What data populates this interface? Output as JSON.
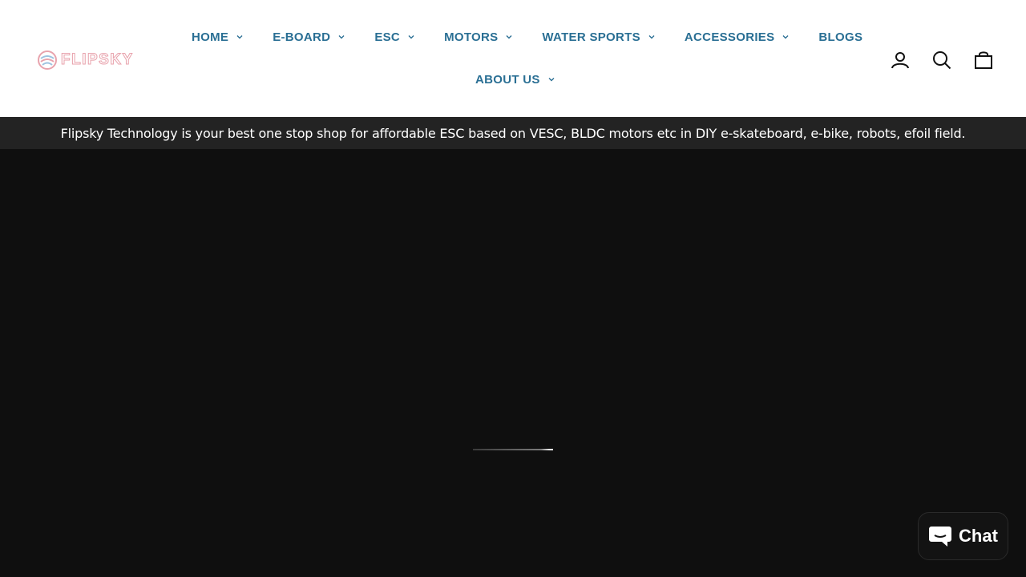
{
  "brand": {
    "logo_text": "FLIPSKY",
    "logo_color": "#e8a3ad"
  },
  "nav": {
    "row1": [
      {
        "label": "HOME",
        "dropdown": true
      },
      {
        "label": "E-BOARD",
        "dropdown": true
      },
      {
        "label": "ESC",
        "dropdown": true
      },
      {
        "label": "MOTORS",
        "dropdown": true
      },
      {
        "label": "WATER SPORTS",
        "dropdown": true
      },
      {
        "label": "ACCESSORIES",
        "dropdown": true
      },
      {
        "label": "BLOGS",
        "dropdown": false
      }
    ],
    "row2": [
      {
        "label": "ABOUT US",
        "dropdown": true
      }
    ],
    "color": "#2a6f94"
  },
  "header_icons": [
    "account-icon",
    "search-icon",
    "cart-icon"
  ],
  "announcement": {
    "text": "Flipsky Technology is your best one stop shop for affordable ESC based on VESC, BLDC motors etc in DIY e-skateboard, e-bike, robots, efoil field.",
    "background": "#232323"
  },
  "hero": {
    "background": "#0f0f0f",
    "loading_progress": 1.0
  },
  "chat": {
    "label": "Chat",
    "icon": "chat-bubble-icon"
  }
}
